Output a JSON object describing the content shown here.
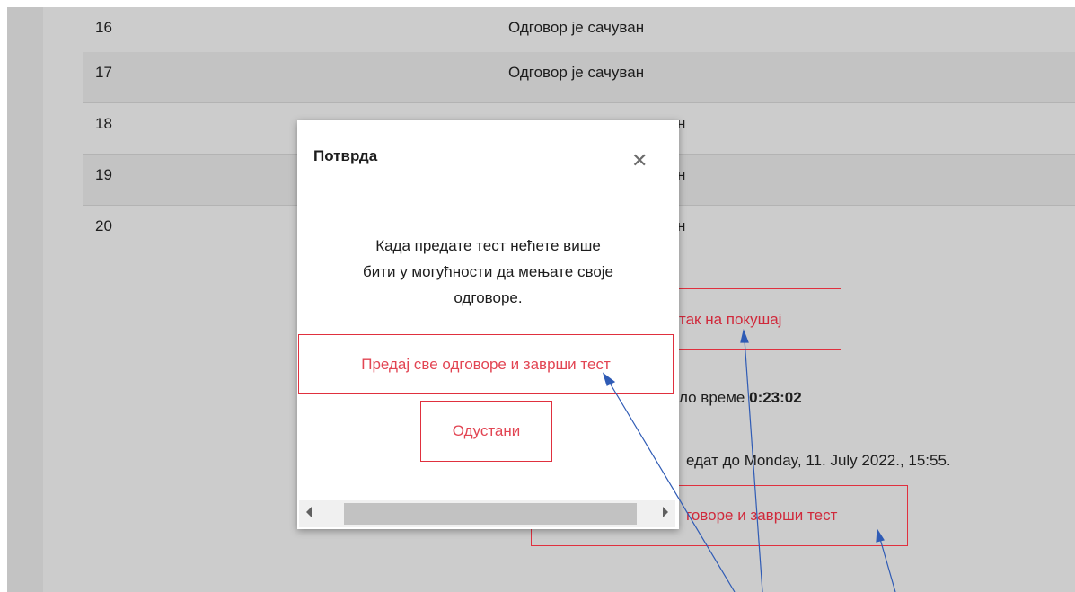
{
  "rows": [
    {
      "num": "16",
      "status": "Одговор је сачуван"
    },
    {
      "num": "17",
      "status": "Одговор је сачуван"
    },
    {
      "num": "18",
      "status": "н"
    },
    {
      "num": "19",
      "status": "н"
    },
    {
      "num": "20",
      "status": "н"
    }
  ],
  "background": {
    "return_button_label": "так на покушај",
    "time_left_prefix": "ло време",
    "time_left_value": "0:23:02",
    "due_text": "едат до Monday, 11. July 2022., 15:55.",
    "submit_button_label": "говоре и заврши тест"
  },
  "modal": {
    "title": "Потврда",
    "close_icon": "close-icon",
    "message_lines": [
      "Када предате тест нећете више",
      "бити у могућности да мењате своје",
      "одговоре."
    ],
    "submit_label": "Предај све одговоре и заврши тест",
    "cancel_label": "Одустани"
  },
  "colors": {
    "accent": "#e0303e",
    "annotation_arrow": "#2f5bb5"
  }
}
